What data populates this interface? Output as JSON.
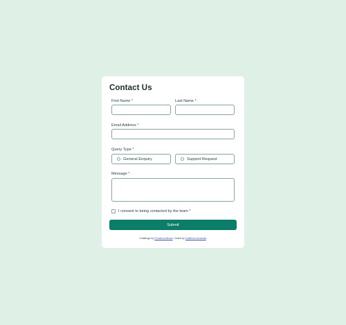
{
  "form": {
    "title": "Contact Us",
    "required_marker": "*",
    "first_name": {
      "label": "First Name",
      "value": ""
    },
    "last_name": {
      "label": "Last Name",
      "value": ""
    },
    "email": {
      "label": "Email Address",
      "value": ""
    },
    "query_type": {
      "label": "Query Type",
      "options": [
        "General Enquiry",
        "Support Request"
      ],
      "selected": null
    },
    "message": {
      "label": "Message",
      "value": ""
    },
    "consent": {
      "label": "I consent to being contacted by the team",
      "checked": false
    },
    "submit_label": "Submit"
  },
  "footer": {
    "prefix": "Challenge by",
    "challenge_link": "Frontend Mentor",
    "middle": ". Coded by",
    "author_link": "Guillermo Armenta",
    "suffix": "."
  },
  "colors": {
    "page_background": "#dff0e6",
    "card_background": "#ffffff",
    "accent": "#0c7d69",
    "border": "#87a3a6",
    "text": "#2a4244"
  }
}
